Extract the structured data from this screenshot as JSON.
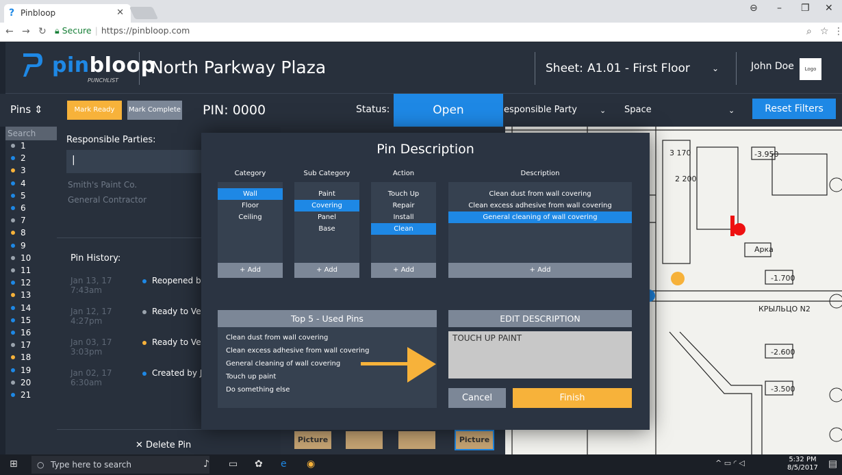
{
  "browser": {
    "tab_title": "Pinbloop",
    "secure_label": "Secure",
    "url": "https://pinbloop.com"
  },
  "header": {
    "brand_prefix": "pin",
    "brand_suffix": "bloop",
    "brand_sub": "PUNCHLIST",
    "project": "North Parkway Plaza",
    "sheet_label": "Sheet:",
    "sheet_value": "A1.01 - First Floor",
    "user": "John Doe",
    "logo_text": "Logo"
  },
  "toolbar": {
    "pins_label": "Pins ⇕",
    "mark_ready": "Mark Ready",
    "mark_complete": "Mark Complete",
    "pin_label": "PIN:  0000",
    "status_label": "Status:",
    "status_value": "Open",
    "responsible_party": "esponsible Party",
    "space": "Space",
    "reset_filters": "Reset Filters"
  },
  "pinlist": {
    "search": "Search",
    "pins": [
      {
        "n": "1",
        "c": "#9aa3ad"
      },
      {
        "n": "2",
        "c": "#1e88e5"
      },
      {
        "n": "3",
        "c": "#f7b23a"
      },
      {
        "n": "4",
        "c": "#1e88e5"
      },
      {
        "n": "5",
        "c": "#1e88e5"
      },
      {
        "n": "6",
        "c": "#1e88e5"
      },
      {
        "n": "7",
        "c": "#9aa3ad"
      },
      {
        "n": "8",
        "c": "#f7b23a"
      },
      {
        "n": "9",
        "c": "#1e88e5"
      },
      {
        "n": "10",
        "c": "#9aa3ad"
      },
      {
        "n": "11",
        "c": "#9aa3ad"
      },
      {
        "n": "12",
        "c": "#1e88e5"
      },
      {
        "n": "13",
        "c": "#f7b23a"
      },
      {
        "n": "14",
        "c": "#1e88e5"
      },
      {
        "n": "15",
        "c": "#1e88e5"
      },
      {
        "n": "16",
        "c": "#1e88e5"
      },
      {
        "n": "17",
        "c": "#9aa3ad"
      },
      {
        "n": "18",
        "c": "#f7b23a"
      },
      {
        "n": "19",
        "c": "#1e88e5"
      },
      {
        "n": "20",
        "c": "#9aa3ad"
      },
      {
        "n": "21",
        "c": "#1e88e5"
      }
    ]
  },
  "leftpanel": {
    "responsible_title": "Responsible Parties:",
    "input_value": "|",
    "parties": [
      "Smith's Paint Co.",
      "General Contractor"
    ],
    "history_title": "Pin History:",
    "history": [
      {
        "date": "Jan 13, 17",
        "time": "7:43am",
        "event": "Reopened by",
        "color": "#1e88e5"
      },
      {
        "date": "Jan 12, 17",
        "time": "4:27pm",
        "event": "Ready to Ver",
        "color": "#9aa3ad"
      },
      {
        "date": "Jan 03, 17",
        "time": "3:03pm",
        "event": "Ready to Ver",
        "color": "#f7b23a"
      },
      {
        "date": "Jan 02, 17",
        "time": "6:30am",
        "event": "Created by J",
        "color": "#1e88e5"
      }
    ],
    "delete": "✕  Delete Pin"
  },
  "modal": {
    "title": "Pin Description",
    "headers": {
      "category": "Category",
      "subcategory": "Sub Category",
      "action": "Action",
      "description": "Description"
    },
    "category": [
      "Wall",
      "Floor",
      "Ceiling"
    ],
    "subcategory": [
      "Paint",
      "Covering",
      "Panel",
      "Base"
    ],
    "action": [
      "Touch Up",
      "Repair",
      "Install",
      "Clean"
    ],
    "description": [
      "Clean dust from wall covering",
      "Clean excess adhesive from wall covering",
      "General cleaning of wall covering"
    ],
    "add_label": "+ Add",
    "top5_title": "Top 5 - Used Pins",
    "top5": [
      "Clean dust from wall covering",
      "Clean excess adhesive from wall covering",
      "General cleaning of wall covering",
      "Touch up paint",
      "Do something else"
    ],
    "edit_title": "EDIT DESCRIPTION",
    "edit_value": "TOUCH UP PAINT",
    "cancel": "Cancel",
    "finish": "Finish"
  },
  "pictures": {
    "label": "Picture"
  },
  "taskbar": {
    "search_placeholder": "Type here to search",
    "time": "5:32 PM",
    "date": "8/5/2017"
  },
  "colors": {
    "accent": "#1e88e5",
    "warning": "#f7b23a",
    "panel": "#28303c"
  }
}
